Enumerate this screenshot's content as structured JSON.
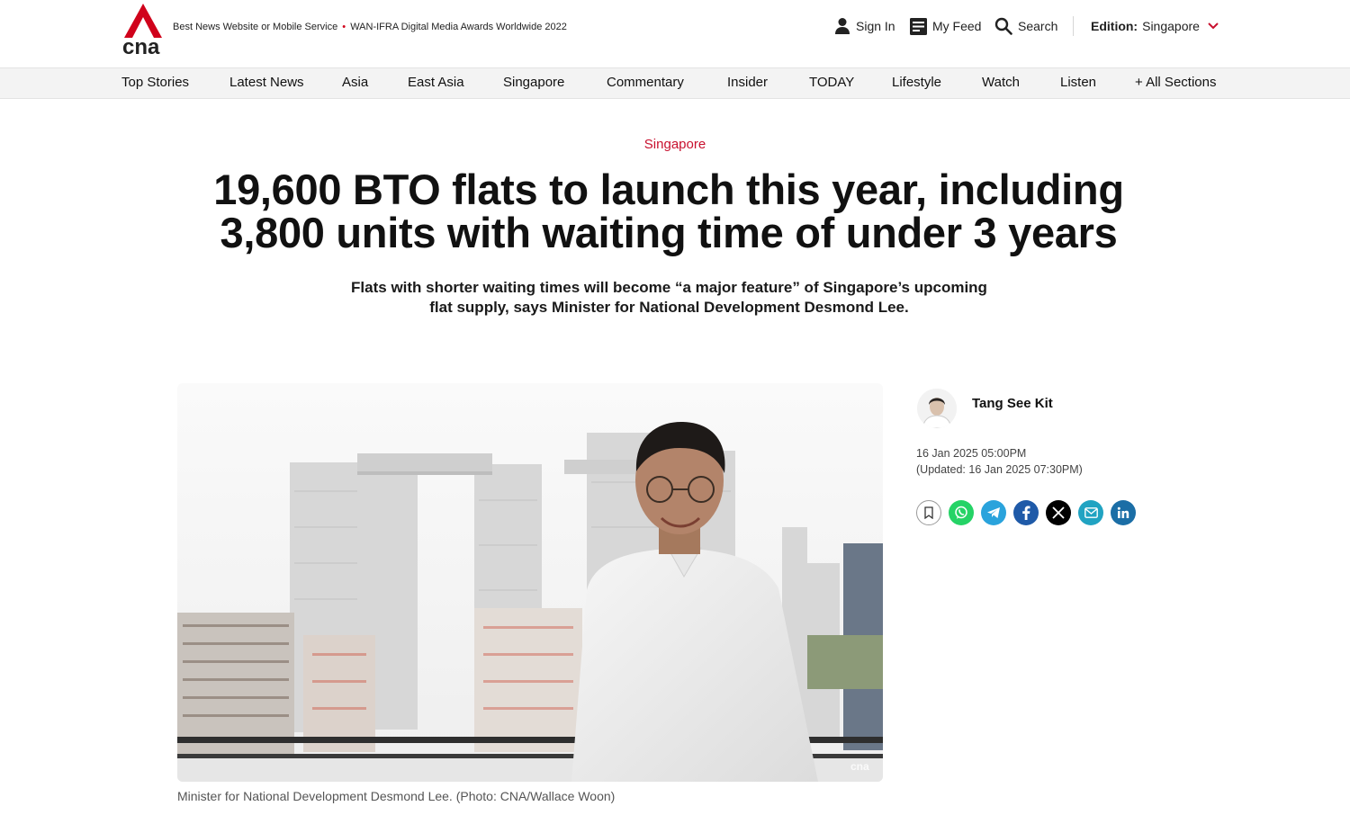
{
  "header": {
    "logo_text": "cna",
    "award_text_1": "Best News Website or Mobile Service",
    "award_separator": "•",
    "award_text_2": "WAN-IFRA Digital Media Awards Worldwide 2022",
    "sign_in": "Sign In",
    "my_feed": "My Feed",
    "search": "Search",
    "edition_label": "Edition:",
    "edition_value": "Singapore",
    "brand_color": "#d0021b"
  },
  "nav": {
    "items": [
      "Top Stories",
      "Latest News",
      "Asia",
      "East Asia",
      "Singapore",
      "Commentary",
      "Insider",
      "TODAY",
      "Lifestyle",
      "Watch",
      "Listen",
      "+ All Sections"
    ]
  },
  "article": {
    "kicker": "Singapore",
    "kicker_color": "#c8102e",
    "headline": "19,600 BTO flats to launch this year, including 3,800 units with waiting time of under 3 years",
    "standfirst": "Flats with shorter waiting times will become “a major feature” of Singapore’s upcoming flat supply, says Minister for National Development Desmond Lee.",
    "image_caption": "Minister for National Development Desmond Lee. (Photo: CNA/Wallace Woon)",
    "image_watermark": "cna",
    "author": "Tang See Kit",
    "published": "16 Jan 2025 05:00PM",
    "updated": "(Updated: 16 Jan 2025 07:30PM)",
    "share_icons": [
      "bookmark-icon",
      "whatsapp-icon",
      "telegram-icon",
      "facebook-icon",
      "x-icon",
      "email-icon",
      "linkedin-icon"
    ]
  }
}
